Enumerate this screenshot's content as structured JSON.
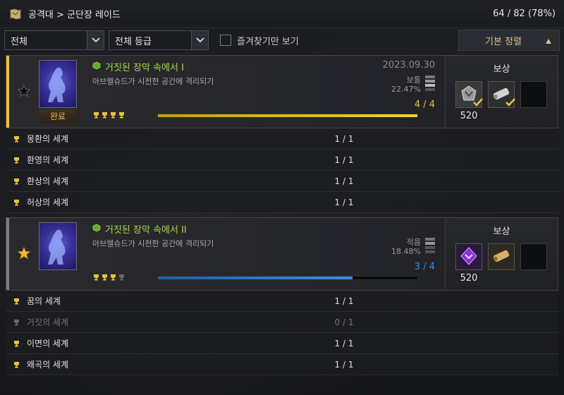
{
  "header": {
    "breadcrumb": "공격대 > 군단장 레이드",
    "progress": "64 / 82 (78%)"
  },
  "filters": {
    "filter1": "전체",
    "filter2": "전체 등급",
    "favorites_label": "즐겨찾기만 보기",
    "sort_label": "기본 정렬"
  },
  "raids": [
    {
      "title": "거짓된 장막 속에서 I",
      "subtitle": "아브렐슈드가 시전한 공간에 격리되기",
      "date": "2023.09.30",
      "difficulty": "보통",
      "percent": "22.47%",
      "count": "4 / 4",
      "progress": 1.0,
      "status_label": "완료",
      "reward_label": "보상",
      "reward_amount": "520",
      "trophies": [
        true,
        true,
        true,
        true
      ],
      "accent": "#e8c33a",
      "stages": [
        {
          "name": "몽환의 세계",
          "count": "1 / 1",
          "complete": true
        },
        {
          "name": "환영의 세계",
          "count": "1 / 1",
          "complete": true
        },
        {
          "name": "환상의 세계",
          "count": "1 / 1",
          "complete": true
        },
        {
          "name": "허상의 세계",
          "count": "1 / 1",
          "complete": true
        }
      ]
    },
    {
      "title": "거짓된 장막 속에서 II",
      "subtitle": "아브렐슈드가 시전한 공간에 격리되기",
      "difficulty": "적음",
      "percent": "18.48%",
      "count": "3 / 4",
      "progress": 0.75,
      "reward_label": "보상",
      "reward_amount": "520",
      "trophies": [
        true,
        true,
        true,
        false
      ],
      "accent": "#3a8fe0",
      "stages": [
        {
          "name": "꿈의 세계",
          "count": "1 / 1",
          "complete": true
        },
        {
          "name": "거짓의 세계",
          "count": "0 / 1",
          "complete": false
        },
        {
          "name": "이면의 세계",
          "count": "1 / 1",
          "complete": true
        },
        {
          "name": "왜곡의 세계",
          "count": "1 / 1",
          "complete": true
        }
      ]
    }
  ]
}
